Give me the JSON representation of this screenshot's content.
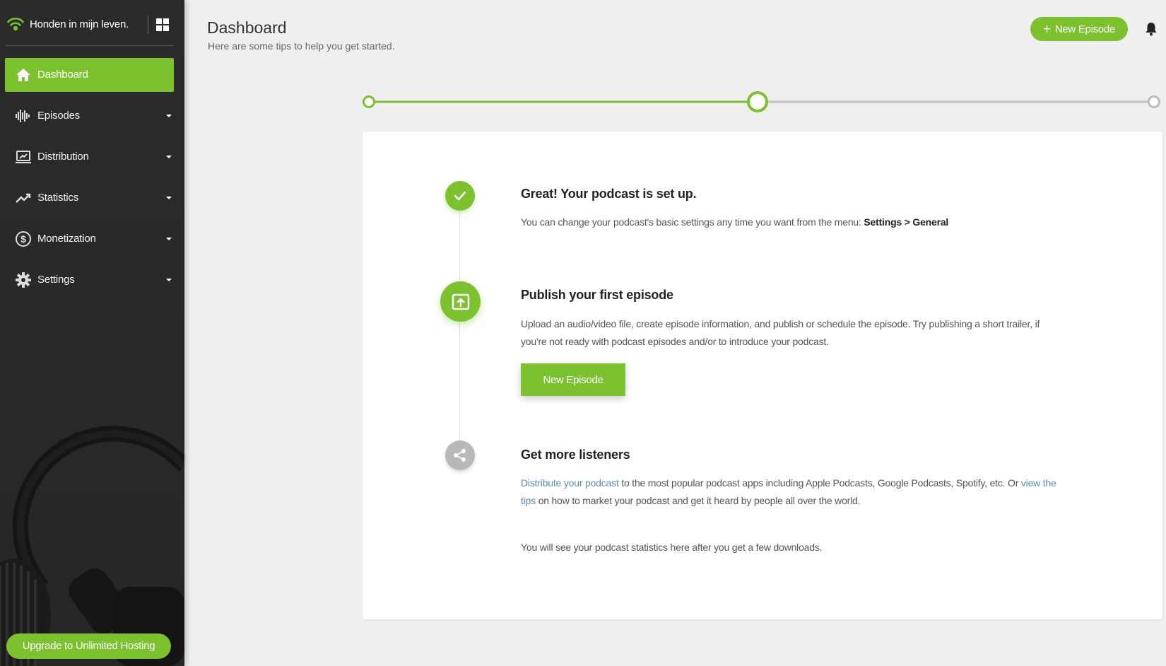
{
  "colors": {
    "accent": "#7cc12e",
    "sidebar_bg": "#2b2b2b",
    "inactive": "#b8b8b8",
    "link": "#5a8fb5"
  },
  "sidebar": {
    "brand": "Honden in mijn leven.",
    "items": [
      {
        "label": "Dashboard",
        "icon": "home-icon",
        "active": true
      },
      {
        "label": "Episodes",
        "icon": "waveform-icon"
      },
      {
        "label": "Distribution",
        "icon": "distribution-icon"
      },
      {
        "label": "Statistics",
        "icon": "trend-icon"
      },
      {
        "label": "Monetization",
        "icon": "dollar-icon"
      },
      {
        "label": "Settings",
        "icon": "gear-icon"
      }
    ],
    "upgrade_label": "Upgrade to Unlimited Hosting"
  },
  "header": {
    "title": "Dashboard",
    "subtitle": "Here are some tips to help you get started.",
    "new_episode_label": "New Episode"
  },
  "stepper": {
    "total_steps": 3,
    "current_step": 2
  },
  "steps": [
    {
      "title": "Great! Your podcast is set up.",
      "text": "You can change your podcast's basic settings any time you want from the menu: ",
      "text_strong": "Settings > General",
      "status": "done"
    },
    {
      "title": "Publish your first episode",
      "text": "Upload an audio/video file, create episode information, and publish or schedule the episode. Try publishing a short trailer, if you're not ready with podcast episodes and/or to introduce your podcast.",
      "button_label": "New Episode",
      "status": "current"
    },
    {
      "title": "Get more listeners",
      "link1": "Distribute your podcast",
      "text_a": " to the most popular podcast apps including Apple Podcasts, Google Podcasts, Spotify, etc. Or ",
      "link2": "view the tips",
      "text_b": " on how to market your podcast and get it heard by people all over the world.",
      "status": "pending"
    }
  ],
  "stats_note": "You will see your podcast statistics here after you get a few downloads."
}
